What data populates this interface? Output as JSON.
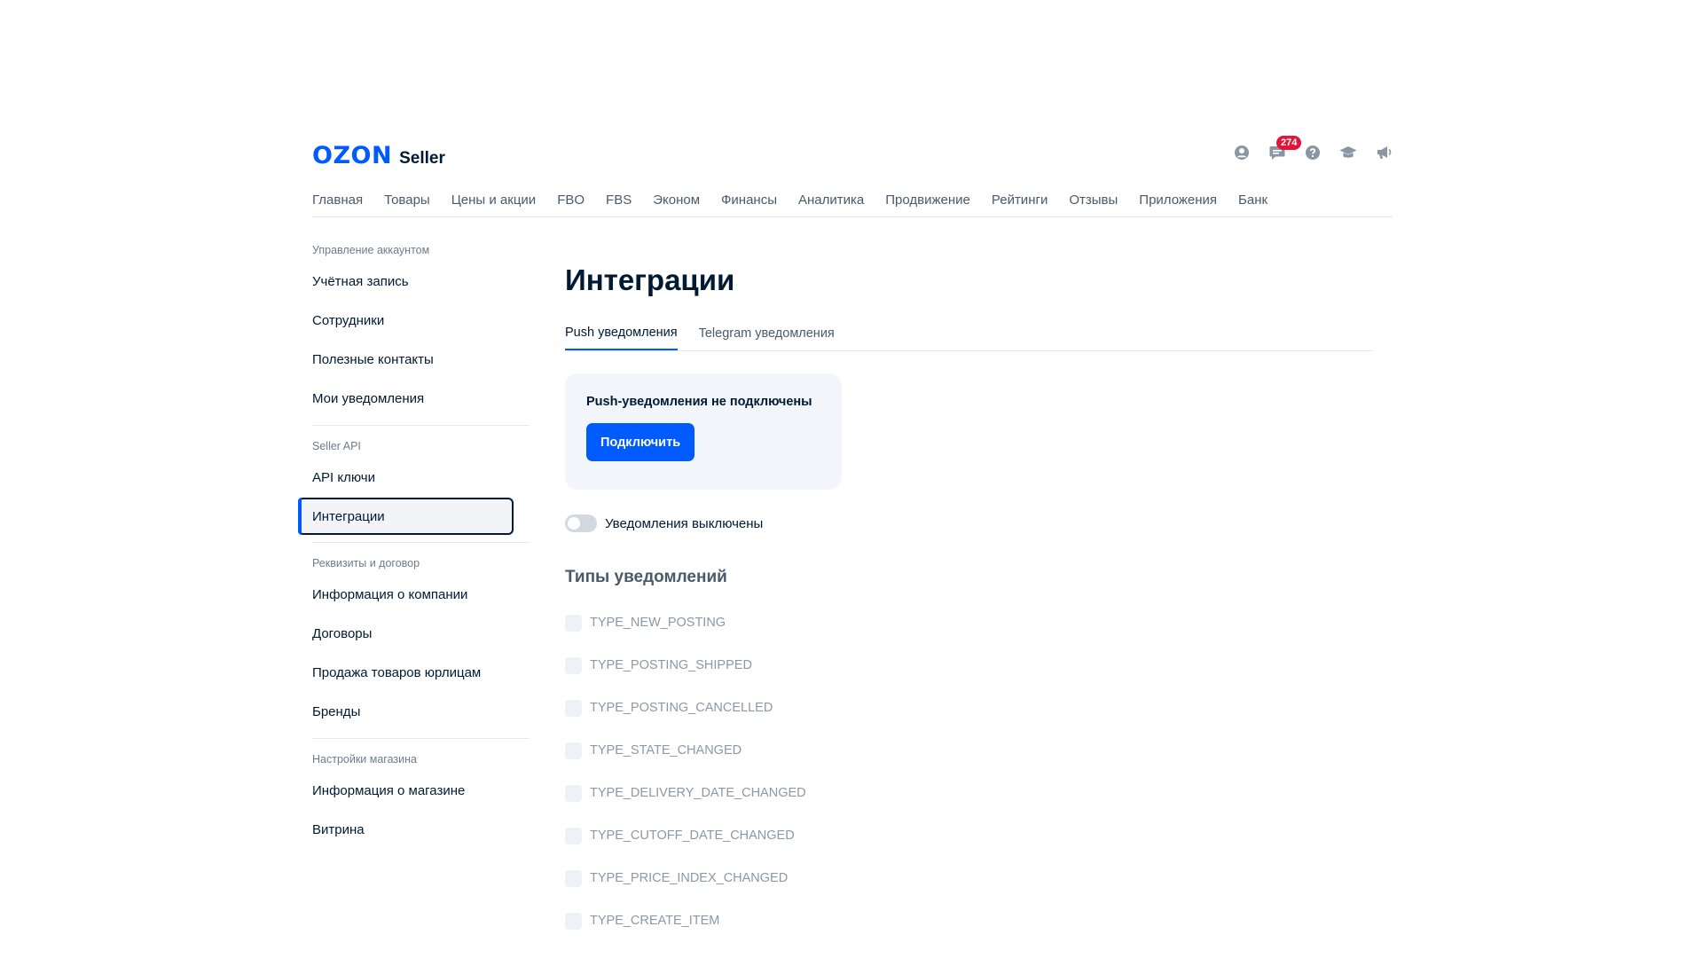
{
  "header": {
    "logo": "OZON",
    "logo_suffix": "Seller",
    "icons": [
      "profile-icon",
      "chat-icon",
      "help-icon",
      "education-icon",
      "announcement-icon"
    ],
    "chat_badge": "274"
  },
  "topnav": [
    "Главная",
    "Товары",
    "Цены и акции",
    "FBO",
    "FBS",
    "Эконом",
    "Финансы",
    "Аналитика",
    "Продвижение",
    "Рейтинги",
    "Отзывы",
    "Приложения",
    "Банк"
  ],
  "sidebar": {
    "sections": [
      {
        "title": "Управление аккаунтом",
        "items": [
          "Учётная запись",
          "Сотрудники",
          "Полезные контакты",
          "Мои уведомления"
        ]
      },
      {
        "title": "Seller API",
        "items": [
          "API ключи",
          "Интеграции"
        ]
      },
      {
        "title": "Реквизиты и договор",
        "items": [
          "Информация о компании",
          "Договоры",
          "Продажа товаров юрлицам",
          "Бренды"
        ]
      },
      {
        "title": "Настройки магазина",
        "items": [
          "Информация о магазине",
          "Витрина"
        ]
      }
    ],
    "active_item": "Интеграции"
  },
  "main": {
    "title": "Интеграции",
    "tabs": [
      "Push уведомления",
      "Telegram уведомления"
    ],
    "active_tab": "Push уведомления",
    "push_card": {
      "text": "Push-уведомления не подключены",
      "button": "Подключить"
    },
    "toggle_label": "Уведомления выключены",
    "toggle_on": false,
    "types_title": "Типы уведомлений",
    "types": [
      "TYPE_NEW_POSTING",
      "TYPE_POSTING_SHIPPED",
      "TYPE_POSTING_CANCELLED",
      "TYPE_STATE_CHANGED",
      "TYPE_DELIVERY_DATE_CHANGED",
      "TYPE_CUTOFF_DATE_CHANGED",
      "TYPE_PRICE_INDEX_CHANGED",
      "TYPE_CREATE_ITEM"
    ]
  },
  "colors": {
    "accent": "#005bff",
    "text": "#001a34",
    "badge": "#e0153a"
  }
}
